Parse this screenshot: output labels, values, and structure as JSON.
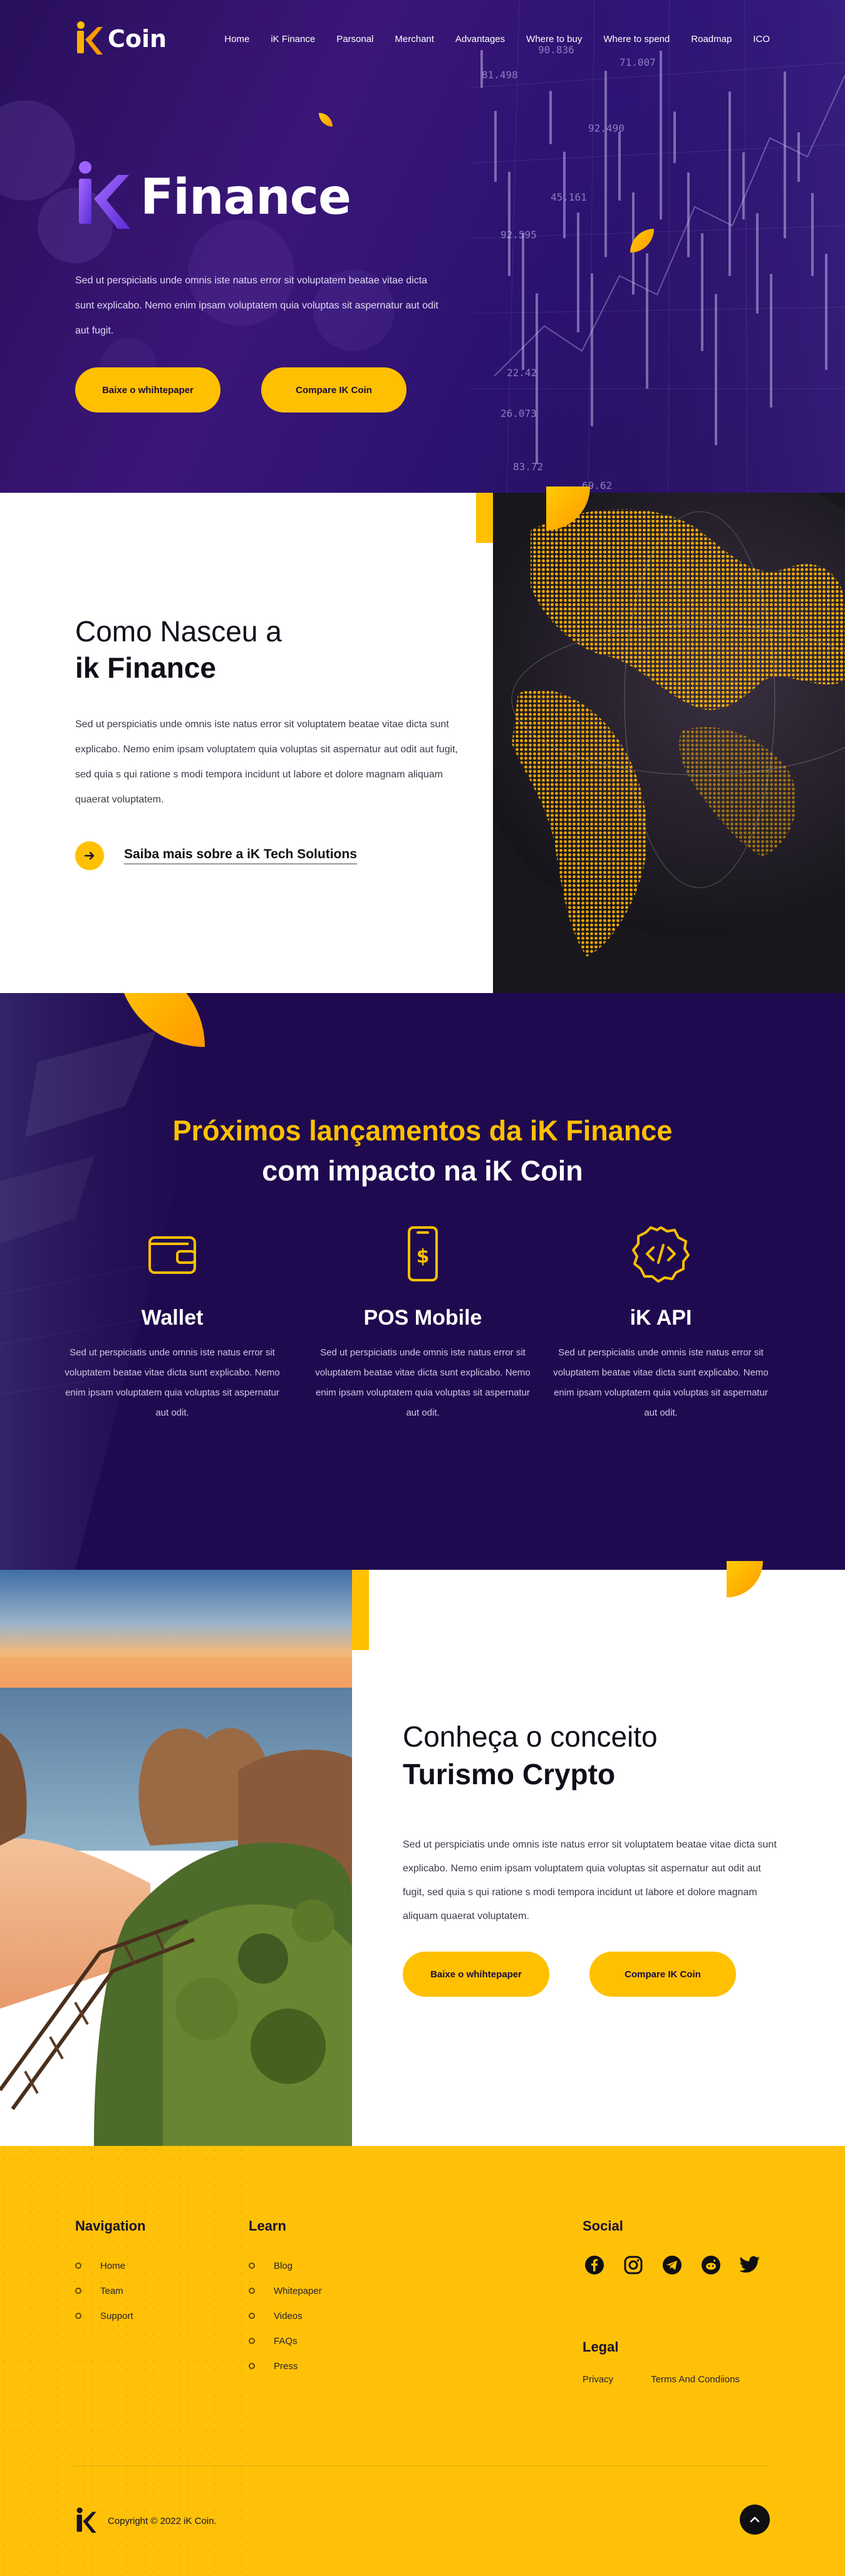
{
  "nav": {
    "logo_text": "Coin",
    "items": [
      "Home",
      "iK Finance",
      "Parsonal",
      "Merchant",
      "Advantages",
      "Where to buy",
      "Where to spend",
      "Roadmap",
      "ICO"
    ]
  },
  "hero": {
    "title": "Finance",
    "description": "Sed ut perspiciatis unde omnis iste natus error sit voluptatem beatae vitae dicta sunt explicabo. Nemo enim ipsam voluptatem quia voluptas sit aspernatur aut odit aut fugit.",
    "btn_primary": "Baixe o whihtepaper",
    "btn_secondary": "Compare IK Coin",
    "chart_numbers": [
      "81.498",
      "90.836",
      "71.007",
      "92.490",
      "45.161",
      "92.595",
      "22.42",
      "26.073",
      "69.62",
      "83.72"
    ]
  },
  "about": {
    "title_line1": "Como Nasceu a",
    "title_line2": "ik Finance",
    "description": "Sed ut perspiciatis unde omnis iste natus error sit voluptatem beatae vitae dicta sunt explicabo. Nemo enim ipsam voluptatem quia voluptas sit aspernatur aut odit aut fugit, sed quia s qui ratione s modi tempora incidunt ut labore et dolore magnam aliquam quaerat voluptatem.",
    "link": "Saiba mais sobre a iK Tech Solutions"
  },
  "products": {
    "heading_line1": "Próximos lançamentos da iK Finance",
    "heading_line2": "com impacto na iK Coin",
    "items": [
      {
        "title": "Wallet",
        "icon": "wallet-icon",
        "text": "Sed ut perspiciatis unde omnis iste natus error sit voluptatem beatae vitae dicta sunt explicabo. Nemo enim ipsam voluptatem quia voluptas sit aspernatur aut odit."
      },
      {
        "title": "POS Mobile",
        "icon": "mobile-pos-icon",
        "text": "Sed ut perspiciatis unde omnis iste natus error sit voluptatem beatae vitae dicta sunt explicabo. Nemo enim ipsam voluptatem quia voluptas sit aspernatur aut odit."
      },
      {
        "title": "iK API",
        "icon": "api-code-icon",
        "text": "Sed ut perspiciatis unde omnis iste natus error sit voluptatem beatae vitae dicta sunt explicabo. Nemo enim ipsam voluptatem quia voluptas sit aspernatur aut odit."
      }
    ]
  },
  "tourism": {
    "title_line1": "Conheça o conceito",
    "title_line2": "Turismo Crypto",
    "description": "Sed ut perspiciatis unde omnis iste natus error sit voluptatem beatae vitae dicta sunt explicabo. Nemo enim ipsam voluptatem quia voluptas sit aspernatur aut odit aut fugit, sed quia s qui ratione s modi tempora incidunt ut labore et dolore magnam aliquam quaerat voluptatem.",
    "btn_primary": "Baixe o whihtepaper",
    "btn_secondary": "Compare IK Coin"
  },
  "footer": {
    "navigation": {
      "title": "Navigation",
      "links": [
        "Home",
        "Team",
        "Support"
      ]
    },
    "learn": {
      "title": "Learn",
      "links": [
        "Blog",
        "Whitepaper",
        "Videos",
        "FAQs",
        "Press"
      ]
    },
    "social": {
      "title": "Social",
      "icons": [
        "facebook-icon",
        "instagram-icon",
        "telegram-icon",
        "reddit-icon",
        "twitter-icon"
      ]
    },
    "legal": {
      "title": "Legal",
      "links": [
        "Privacy",
        "Terms And Condiions"
      ]
    },
    "copyright": "Copyright © 2022 iK Coin."
  },
  "colors": {
    "brand_purple": "#2a0f5c",
    "accent_yellow": "#ffc000",
    "footer_yellow": "#ffc107",
    "dark_section": "#1f0a4f"
  }
}
